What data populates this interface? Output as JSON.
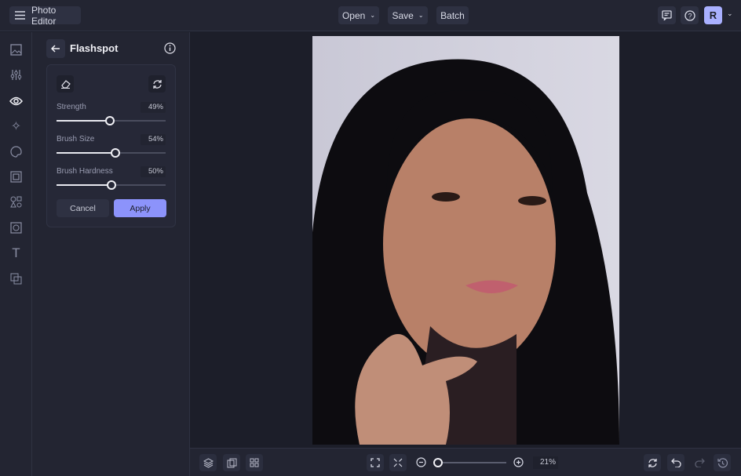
{
  "app": {
    "title": "Photo Editor"
  },
  "toolbar": {
    "open_label": "Open",
    "save_label": "Save",
    "batch_label": "Batch",
    "avatar_initial": "R"
  },
  "panel": {
    "title": "Flashspot",
    "sliders": [
      {
        "label": "Strength",
        "value": "49%",
        "percent": 49
      },
      {
        "label": "Brush Size",
        "value": "54%",
        "percent": 54
      },
      {
        "label": "Brush Hardness",
        "value": "50%",
        "percent": 50
      }
    ],
    "cancel_label": "Cancel",
    "apply_label": "Apply"
  },
  "bottom": {
    "zoom_value": "21%",
    "zoom_percent": 3
  },
  "colors": {
    "accent": "#8c93fb",
    "avatar": "#a9b0ff"
  }
}
